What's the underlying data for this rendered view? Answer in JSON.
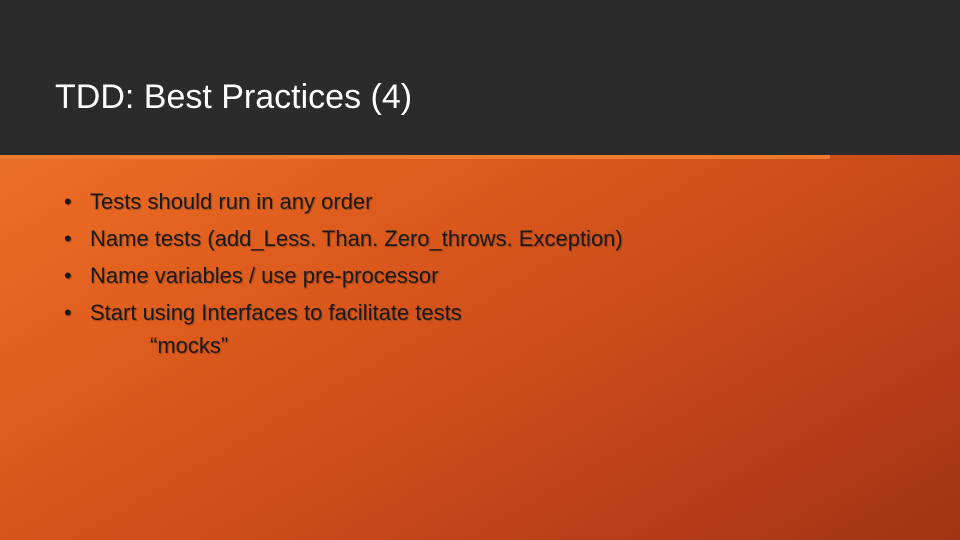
{
  "slide": {
    "title": "TDD: Best Practices (4)",
    "bullets": [
      {
        "text": "Tests should run in any order"
      },
      {
        "text": "Name tests (add_Less. Than. Zero_throws. Exception)"
      },
      {
        "text": "Name variables / use pre-processor"
      },
      {
        "text": "Start using Interfaces to facilitate tests",
        "sub": "“mocks”"
      }
    ]
  },
  "colors": {
    "title_bar": "#2b2b2b",
    "accent": "#ef7b2e",
    "text": "#1a1a1a",
    "title_fg": "#ffffff"
  }
}
